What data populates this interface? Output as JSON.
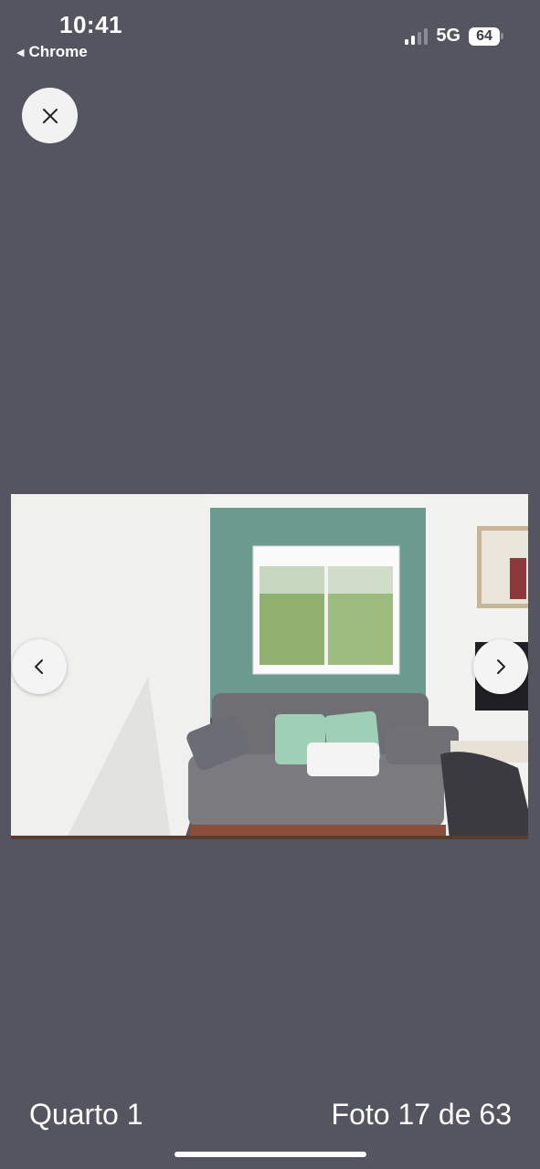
{
  "status_bar": {
    "time": "10:41",
    "back_app": "Chrome",
    "network": "5G",
    "battery": "64"
  },
  "gallery": {
    "close_icon": "close-icon",
    "prev_icon": "chevron-left-icon",
    "next_icon": "chevron-right-icon",
    "caption": "Quarto 1",
    "counter": "Foto 17 de 63"
  },
  "colors": {
    "background": "#555561",
    "accent_wall": "#6b9a8f",
    "button": "#f2f2f2"
  }
}
